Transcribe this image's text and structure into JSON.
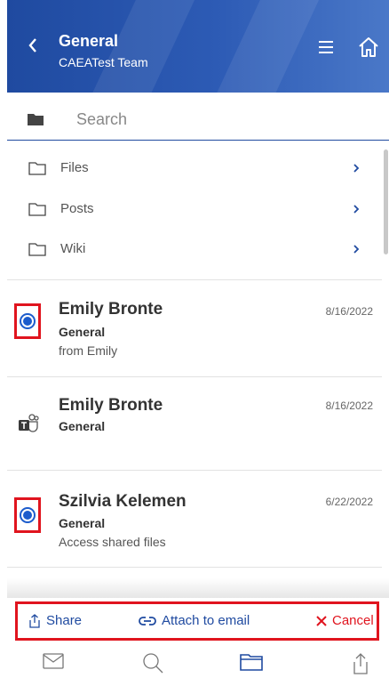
{
  "header": {
    "title": "General",
    "subtitle": "CAEATest Team"
  },
  "search": {
    "placeholder": "Search"
  },
  "nav_items": [
    {
      "label": "Files",
      "icon": "folder-icon"
    },
    {
      "label": "Posts",
      "icon": "folder-icon"
    },
    {
      "label": "Wiki",
      "icon": "folder-icon"
    }
  ],
  "messages": [
    {
      "name": "Emily Bronte",
      "channel": "General",
      "snippet": "from Emily",
      "date": "8/16/2022",
      "selected": true
    },
    {
      "name": "Emily Bronte",
      "channel": "General",
      "snippet": "",
      "date": "8/16/2022",
      "selected": false,
      "icon": "teams-icon"
    },
    {
      "name": "Szilvia Kelemen",
      "channel": "General",
      "snippet": "Access shared files",
      "date": "6/22/2022",
      "selected": true
    }
  ],
  "actions": {
    "share": "Share",
    "attach": "Attach to email",
    "cancel": "Cancel"
  },
  "colors": {
    "accent": "#1f4aa0",
    "highlight": "#e0141e",
    "radio": "#1c5ccc"
  },
  "tabs": [
    "mail-icon",
    "search-icon",
    "folder-icon",
    "share-icon"
  ]
}
